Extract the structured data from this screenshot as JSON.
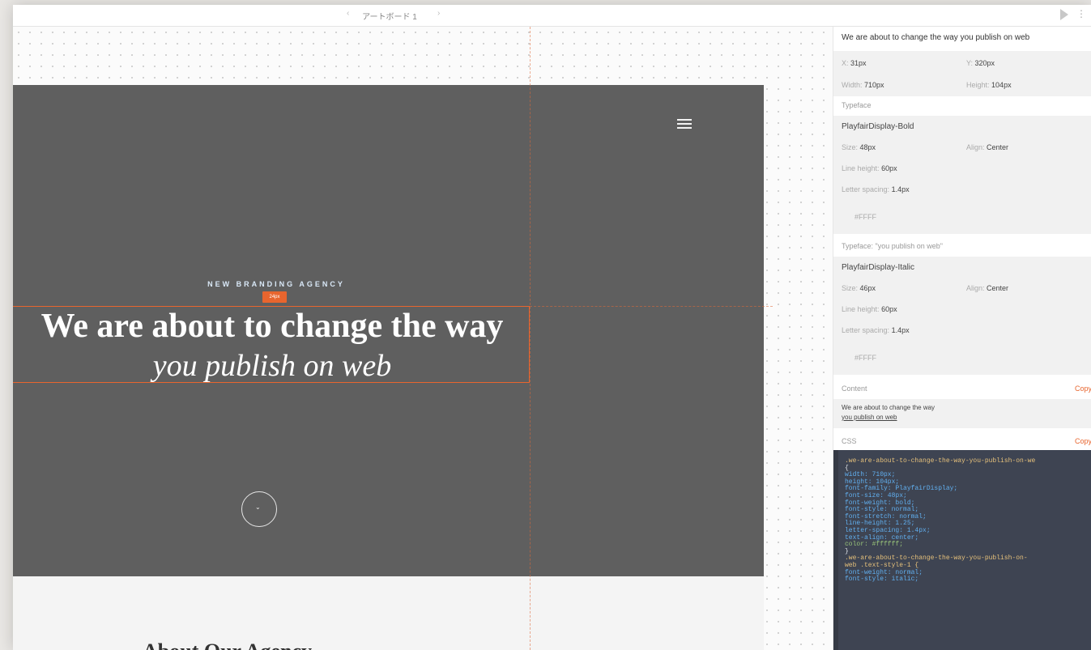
{
  "app": {
    "title": "アートボード 1",
    "prev_arrow": "‹",
    "next_arrow": "›",
    "more": "⋮"
  },
  "artboard": {
    "eyebrow": "NEW BRANDING AGENCY",
    "measure_label": "24px",
    "headline": "We are about to change the way",
    "subline": "you publish on web",
    "below_title": "About Our Agency",
    "colors": {
      "hero_bg": "#5f5f5f",
      "selection": "#e8652e",
      "eyebrow": "#d9e8f7"
    }
  },
  "inspector": {
    "layer_name": "We are about to change the way  you publish on web",
    "x": {
      "label": "X:",
      "value": "31px"
    },
    "y": {
      "label": "Y:",
      "value": "320px"
    },
    "width": {
      "label": "Width:",
      "value": "710px"
    },
    "height": {
      "label": "Height:",
      "value": "104px"
    },
    "typeface_section": "Typeface",
    "typeface1": {
      "name": "PlayfairDisplay-Bold",
      "size_label": "Size:",
      "size": "48px",
      "align_label": "Align:",
      "align": "Center",
      "line_height_label": "Line height:",
      "line_height": "60px",
      "letter_spacing_label": "Letter spacing:",
      "letter_spacing": "1.4px",
      "color": "#FFFF"
    },
    "typeface2_section": "Typeface: \"you publish on web\"",
    "typeface2": {
      "name": "PlayfairDisplay-Italic",
      "size_label": "Size:",
      "size": "46px",
      "align_label": "Align:",
      "align": "Center",
      "line_height_label": "Line height:",
      "line_height": "60px",
      "letter_spacing_label": "Letter spacing:",
      "letter_spacing": "1.4px",
      "color": "#FFFF"
    },
    "content_section": "Content",
    "content_line1": "We are about to change the way",
    "content_line2": "you publish on web",
    "css_section": "CSS",
    "copy_label": "Copy",
    "css_lines": [
      ".we-are-about-to-change-the-way-you-publish-on-we",
      "  {",
      "  width: 710px;",
      "  height: 104px;",
      "  font-family: PlayfairDisplay;",
      "  font-size: 48px;",
      "  font-weight: bold;",
      "  font-style: normal;",
      "  font-stretch: normal;",
      "  line-height: 1.25;",
      "  letter-spacing: 1.4px;",
      "  text-align: center;",
      "  color: #ffffff;",
      "}",
      "",
      ".we-are-about-to-change-the-way-you-publish-on-",
      "  web .text-style-1 {",
      "  font-weight: normal;",
      "  font-style: italic;"
    ]
  }
}
